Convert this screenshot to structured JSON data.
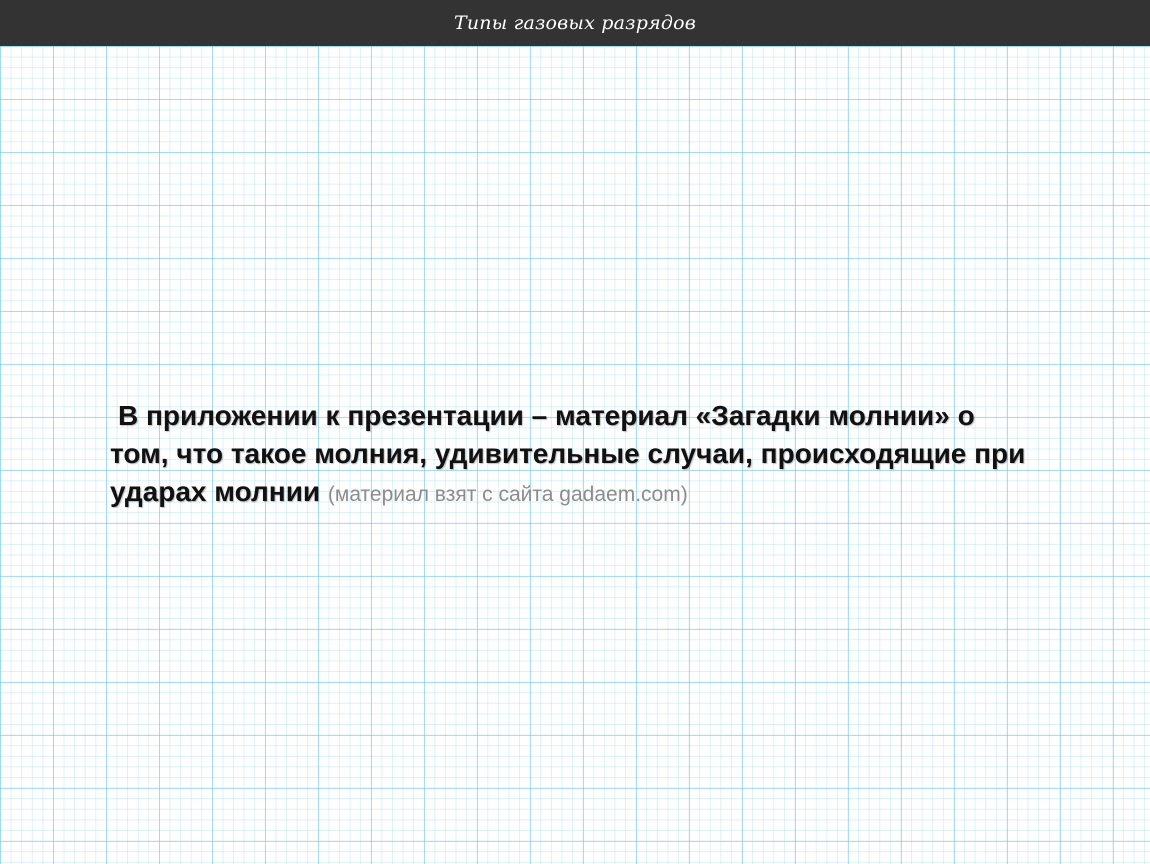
{
  "header": {
    "title": "Типы газовых  разрядов"
  },
  "slide": {
    "body_line1": "В приложении к презентации – материал «Загадки молнии» о",
    "body_line2": "том, что такое молния, удивительные случаи, происходящие при",
    "body_line3": "ударах молнии",
    "source_note": "(материал взят с сайта gadaem.com)"
  },
  "colors": {
    "title_bar": "#333333",
    "grid": "#78c8e6",
    "text": "#111111",
    "source_text": "#8c8c8c"
  }
}
